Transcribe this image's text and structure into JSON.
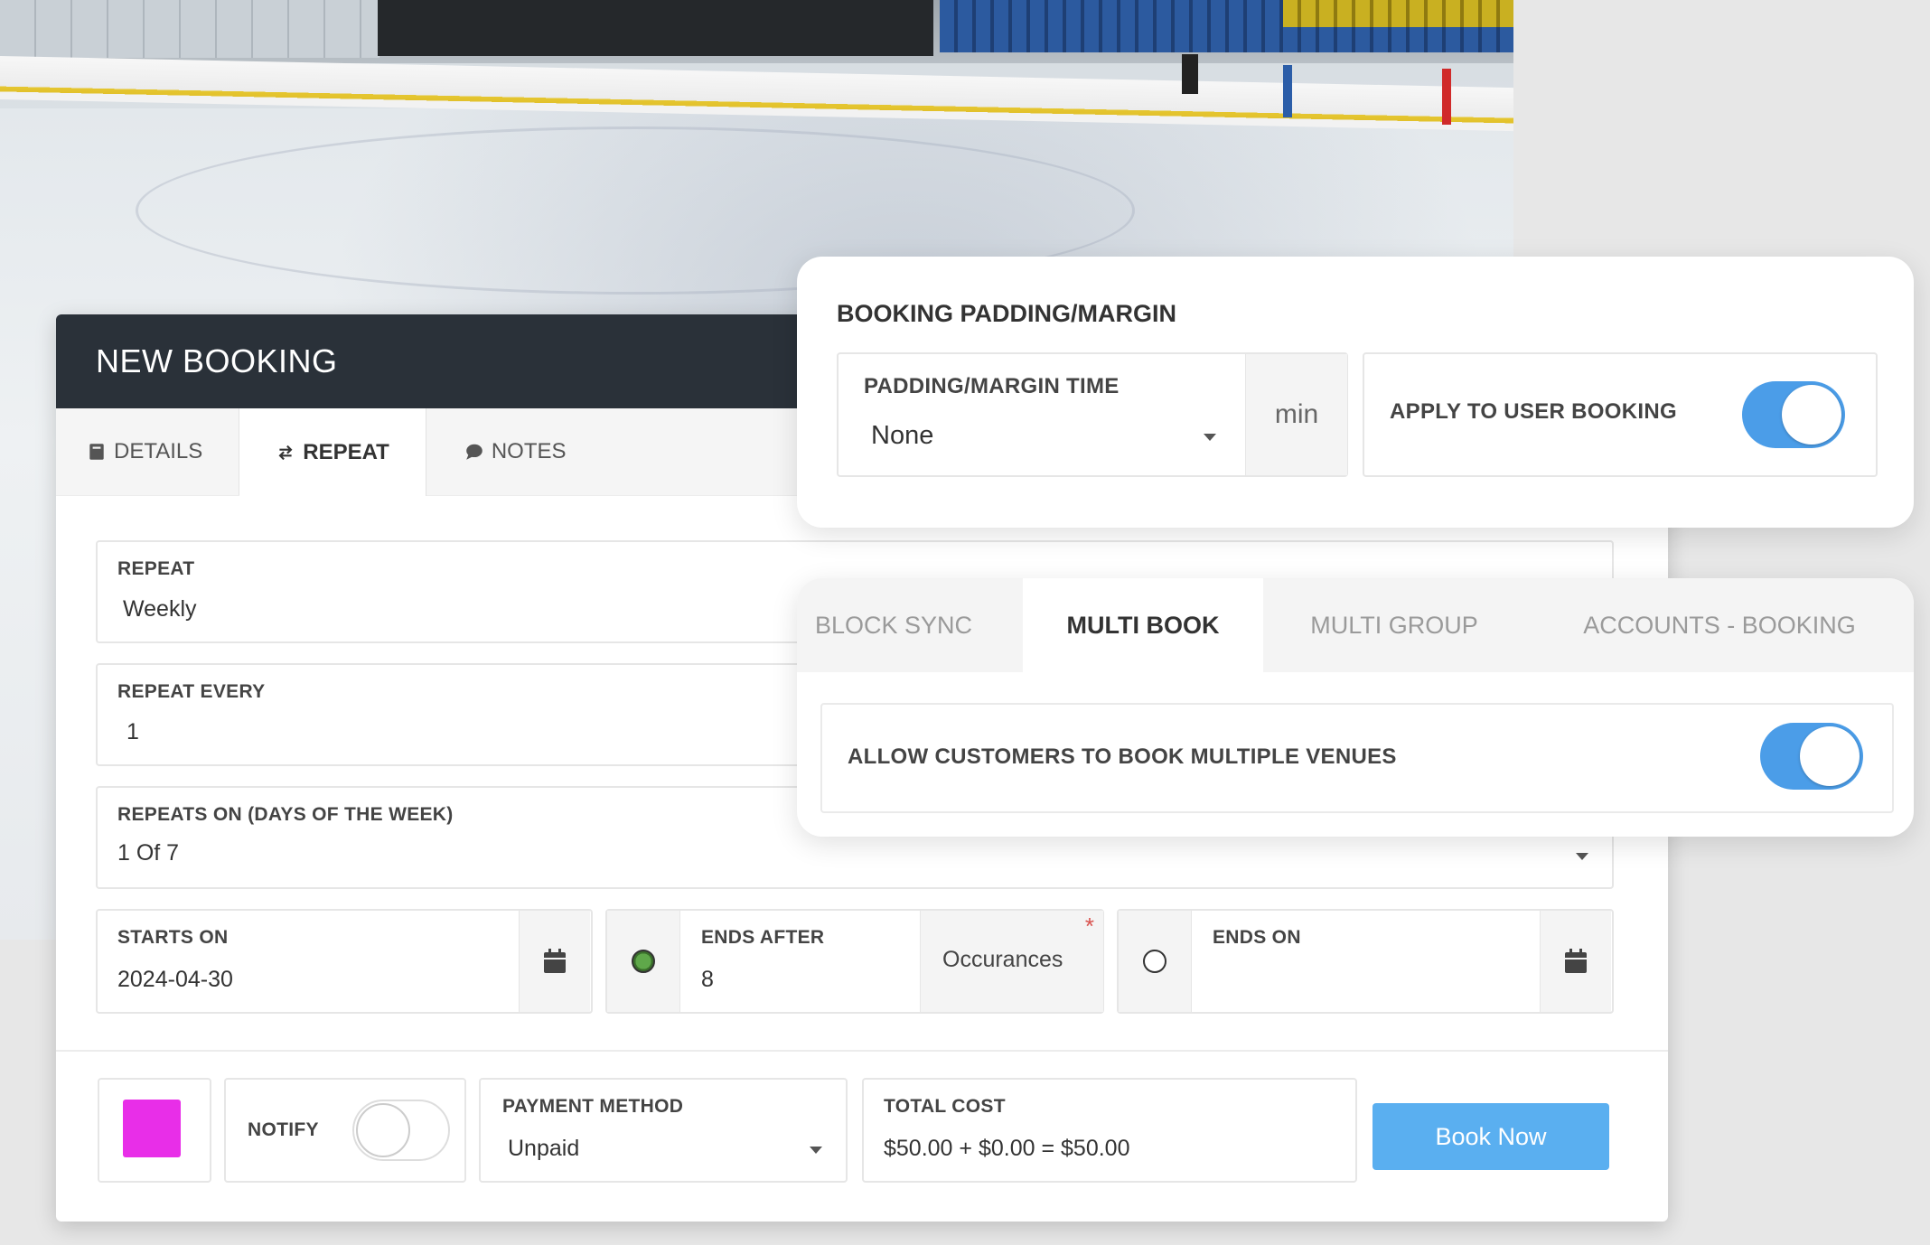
{
  "booking": {
    "title": "NEW BOOKING",
    "tabs": [
      {
        "label": "DETAILS",
        "icon": "book-icon",
        "active": false
      },
      {
        "label": "REPEAT",
        "icon": "repeat-icon",
        "active": true
      },
      {
        "label": "NOTES",
        "icon": "comment-icon",
        "active": false
      }
    ],
    "repeat": {
      "label": "REPEAT",
      "value": "Weekly"
    },
    "repeat_every": {
      "label": "REPEAT EVERY",
      "value": "1"
    },
    "repeats_on": {
      "label": "REPEATS ON (DAYS OF THE WEEK)",
      "value": "1 Of 7"
    },
    "starts_on": {
      "label": "STARTS ON",
      "value": "2024-04-30"
    },
    "ends_after": {
      "label": "ENDS AFTER",
      "value": "8",
      "unit": "Occurances",
      "required": "*",
      "selected": true
    },
    "ends_on": {
      "label": "ENDS ON",
      "value": "",
      "selected": false
    },
    "footer": {
      "color": "#e82ee8",
      "notify_label": "NOTIFY",
      "notify_on": false,
      "payment_label": "PAYMENT METHOD",
      "payment_value": "Unpaid",
      "total_label": "TOTAL COST",
      "total_value": "$50.00 + $0.00 = $50.00",
      "book_button": "Book Now"
    }
  },
  "padding_card": {
    "title": "BOOKING PADDING/MARGIN",
    "padding_label": "PADDING/MARGIN TIME",
    "padding_value": "None",
    "unit": "min",
    "apply_label": "APPLY TO USER BOOKING",
    "apply_on": true
  },
  "multi_card": {
    "tabs": [
      {
        "label": "BLOCK SYNC",
        "active": false
      },
      {
        "label": "MULTI BOOK",
        "active": true
      },
      {
        "label": "MULTI GROUP",
        "active": false
      },
      {
        "label": "ACCOUNTS - BOOKING",
        "active": false
      }
    ],
    "allow_label": "ALLOW CUSTOMERS TO BOOK MULTIPLE VENUES",
    "allow_on": true
  },
  "colors": {
    "header_bg": "#2a3139",
    "accent": "#4b9de8",
    "button": "#5aaff0",
    "swatch": "#e82ee8"
  }
}
